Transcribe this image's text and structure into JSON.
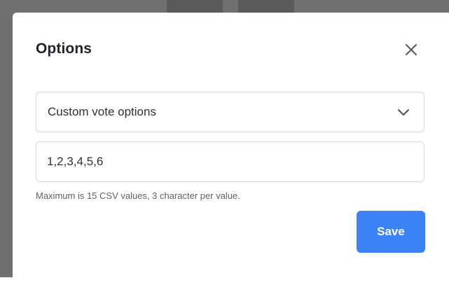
{
  "modal": {
    "title": "Options",
    "close_icon": "close-icon",
    "select": {
      "value": "Custom vote options",
      "icon": "chevron-down-icon"
    },
    "input": {
      "value": "1,2,3,4,5,6"
    },
    "help_text": "Maximum is 15 CSV values, 3 character per value.",
    "save_label": "Save"
  },
  "colors": {
    "backdrop": "#6f6f6f",
    "modal_bg": "#ffffff",
    "field_border": "#d4d7db",
    "text": "#212529",
    "help_text": "#5d6268",
    "primary": "#3b82f6"
  }
}
